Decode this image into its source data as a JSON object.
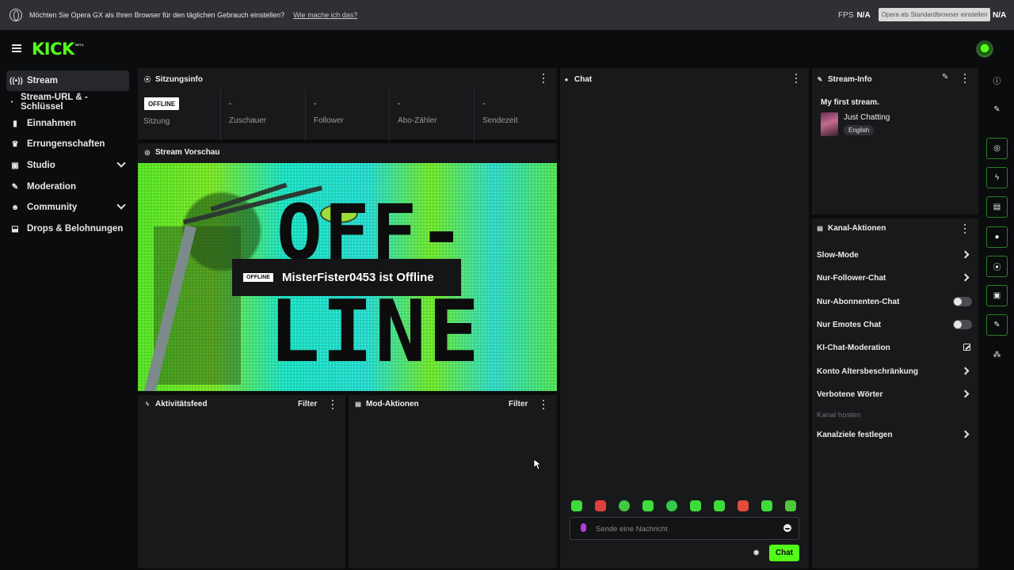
{
  "opera_bar": {
    "message": "Möchten Sie Opera GX als Ihren Browser für den täglichen Gebrauch einstellen?",
    "link": "Wie mache ich das?",
    "fps_label": "FPS",
    "fps_value": "N/A",
    "standard_button": "Opera als Standardbrowser einstellen",
    "na_value": "N/A"
  },
  "header": {
    "logo": "KICK",
    "beta": "BETA"
  },
  "sidebar": {
    "items": [
      {
        "label": "Stream",
        "icon": "broadcast-icon"
      },
      {
        "label": "Stream-URL & -Schlüssel",
        "icon": "dot-icon"
      },
      {
        "label": "Einnahmen",
        "icon": "bar-chart-icon"
      },
      {
        "label": "Errungenschaften",
        "icon": "trophy-icon"
      },
      {
        "label": "Studio",
        "icon": "studio-icon"
      },
      {
        "label": "Moderation",
        "icon": "wrench-icon"
      },
      {
        "label": "Community",
        "icon": "users-icon"
      },
      {
        "label": "Drops & Belohnungen",
        "icon": "drops-icon"
      }
    ]
  },
  "session": {
    "title": "Sitzungsinfo",
    "badge": "OFFLINE",
    "stats": [
      {
        "value": "",
        "label": "Sitzung"
      },
      {
        "value": "-",
        "label": "Zuschauer"
      },
      {
        "value": "-",
        "label": "Follower"
      },
      {
        "value": "-",
        "label": "Abo-Zähler"
      },
      {
        "value": "-",
        "label": "Sendezeit"
      }
    ]
  },
  "preview": {
    "title": "Stream Vorschau",
    "bg_line1": "OFF-",
    "bg_line2": "LINE",
    "tag": "OFFLINE",
    "message": "MisterFister0453 ist Offline"
  },
  "activity": {
    "title": "Aktivitätsfeed",
    "filter": "Filter"
  },
  "mod_actions": {
    "title": "Mod-Aktionen",
    "filter": "Filter"
  },
  "chat": {
    "title": "Chat",
    "placeholder": "Sende eine Nachricht",
    "send": "Chat",
    "emote_colors": [
      "#3ddc3a",
      "#e0403c",
      "#43c844",
      "#3ddc3a",
      "#35c94b",
      "#3ddc3a",
      "#3ddc3a",
      "#e24b3d",
      "#3ddc3a",
      "#4cc83a"
    ]
  },
  "stream_info": {
    "title": "Stream-Info",
    "stream_title": "My first stream.",
    "category": "Just Chatting",
    "language": "English"
  },
  "channel_actions": {
    "title": "Kanal-Aktionen",
    "rows": [
      {
        "label": "Slow-Mode",
        "control": "arrow"
      },
      {
        "label": "Nur-Follower-Chat",
        "control": "arrow"
      },
      {
        "label": "Nur-Abonnenten-Chat",
        "control": "toggle"
      },
      {
        "label": "Nur Emotes Chat",
        "control": "toggle"
      },
      {
        "label": "KI-Chat-Moderation",
        "control": "external"
      },
      {
        "label": "Konto Altersbeschränkung",
        "control": "arrow"
      },
      {
        "label": "Verbotene Wörter",
        "control": "arrow"
      },
      {
        "label": "Kanal hosten",
        "control": "none"
      },
      {
        "label": "Kanalziele festlegen",
        "control": "arrow"
      }
    ]
  },
  "colors": {
    "accent": "#53fc18",
    "panel": "#18191b",
    "background": "#0b0c0d"
  }
}
